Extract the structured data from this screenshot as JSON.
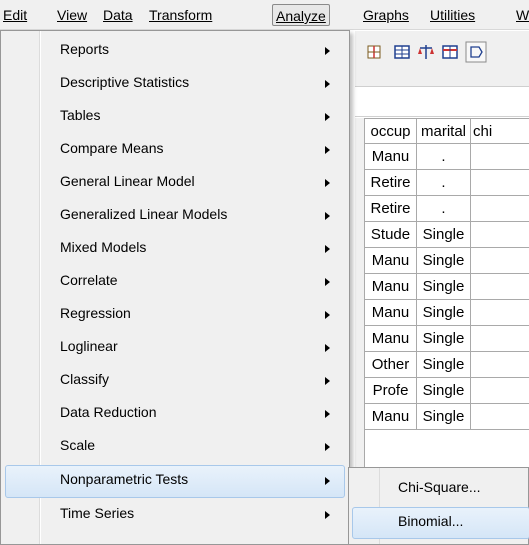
{
  "menubar": {
    "items": [
      {
        "label": "Edit"
      },
      {
        "label": "View"
      },
      {
        "label": "Data"
      },
      {
        "label": "Transform"
      },
      {
        "label": "Analyze",
        "active": true
      },
      {
        "label": "Graphs"
      },
      {
        "label": "Utilities"
      },
      {
        "label": "W"
      }
    ]
  },
  "grid": {
    "headers": [
      "occup",
      "marital",
      "chi"
    ],
    "rows": [
      [
        "Manu",
        ".",
        ""
      ],
      [
        "Retire",
        ".",
        ""
      ],
      [
        "Retire",
        ".",
        ""
      ],
      [
        "Stude",
        "Single",
        ""
      ],
      [
        "Manu",
        "Single",
        ""
      ],
      [
        "Manu",
        "Single",
        ""
      ],
      [
        "Manu",
        "Single",
        ""
      ],
      [
        "Manu",
        "Single",
        ""
      ],
      [
        "Other",
        "Single",
        ""
      ],
      [
        "Profe",
        "Single",
        ""
      ],
      [
        "Manu",
        "Single",
        ""
      ]
    ]
  },
  "analyze_menu": {
    "items": [
      {
        "label": "Reports"
      },
      {
        "label": "Descriptive Statistics"
      },
      {
        "label": "Tables"
      },
      {
        "label": "Compare Means"
      },
      {
        "label": "General Linear Model"
      },
      {
        "label": "Generalized Linear Models"
      },
      {
        "label": "Mixed Models"
      },
      {
        "label": "Correlate"
      },
      {
        "label": "Regression"
      },
      {
        "label": "Loglinear"
      },
      {
        "label": "Classify"
      },
      {
        "label": "Data Reduction"
      },
      {
        "label": "Scale"
      },
      {
        "label": "Nonparametric Tests",
        "highlighted": true
      },
      {
        "label": "Time Series"
      }
    ]
  },
  "nonparametric_submenu": {
    "items": [
      {
        "label": "Chi-Square..."
      },
      {
        "label": "Binomial...",
        "highlighted": true
      }
    ]
  },
  "colors": {
    "menu_bg": "#f0f0f0",
    "highlight_bg": "#d5e6f7",
    "highlight_border": "#a8c8ea"
  }
}
